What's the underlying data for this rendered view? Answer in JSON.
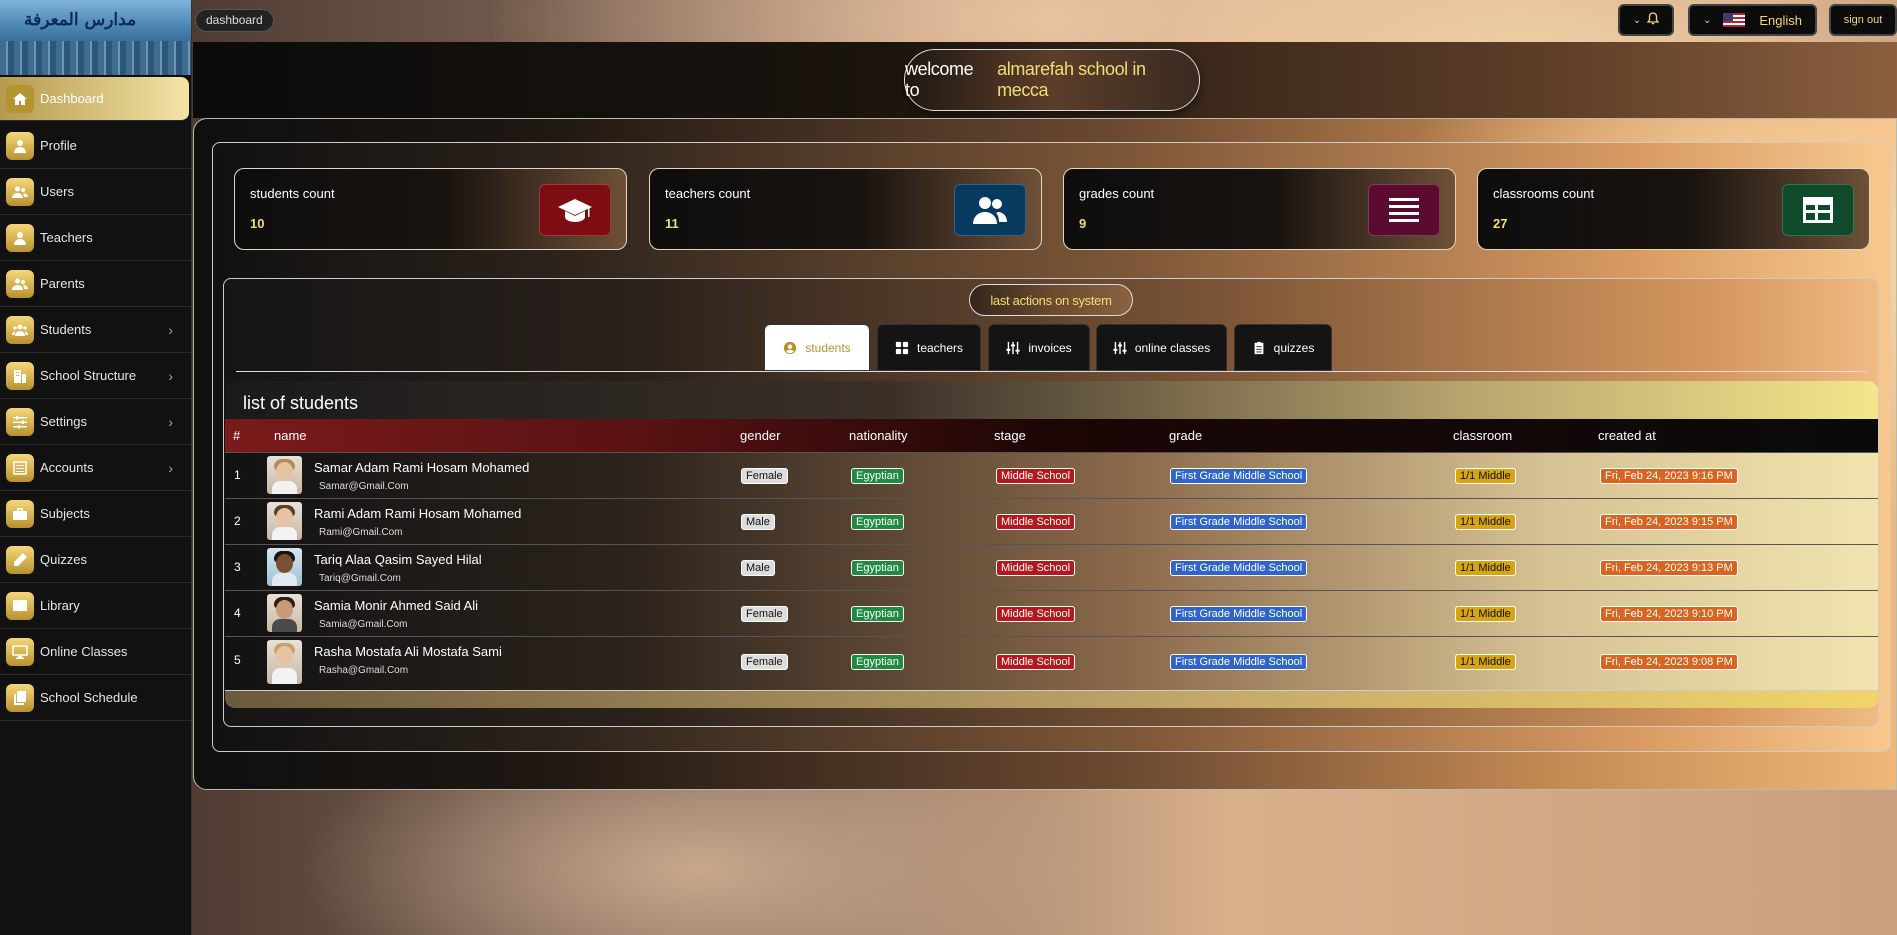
{
  "breadcrumb": "dashboard",
  "header": {
    "language": "English",
    "signout": "sign out"
  },
  "logo_text": "مدارس المعرفة",
  "welcome": {
    "prefix": "welcome to",
    "school": "almarefah school in mecca"
  },
  "sidebar": {
    "items": [
      {
        "label": "Dashboard",
        "icon": "home-icon"
      },
      {
        "label": "Profile",
        "icon": "user-icon"
      },
      {
        "label": "Users",
        "icon": "users-icon"
      },
      {
        "label": "Teachers",
        "icon": "user-icon"
      },
      {
        "label": "Parents",
        "icon": "users-icon"
      },
      {
        "label": "Students",
        "icon": "group-icon"
      },
      {
        "label": "School Structure",
        "icon": "building-icon"
      },
      {
        "label": "Settings",
        "icon": "sliders-icon"
      },
      {
        "label": "Accounts",
        "icon": "list-icon"
      },
      {
        "label": "Subjects",
        "icon": "briefcase-icon"
      },
      {
        "label": "Quizzes",
        "icon": "pencil-icon"
      },
      {
        "label": "Library",
        "icon": "book-icon"
      },
      {
        "label": "Online Classes",
        "icon": "monitor-icon"
      },
      {
        "label": "School Schedule",
        "icon": "copy-icon"
      }
    ]
  },
  "cards": [
    {
      "title": "students count",
      "value": "10",
      "icon": "graduation-cap-icon",
      "color": "#7d0d13"
    },
    {
      "title": "teachers count",
      "value": "11",
      "icon": "users-icon",
      "color": "#073a5e"
    },
    {
      "title": "grades count",
      "value": "9",
      "icon": "list-icon",
      "color": "#5a0b2f"
    },
    {
      "title": "classrooms count",
      "value": "27",
      "icon": "table-icon",
      "color": "#0f4a2b"
    }
  ],
  "last_actions": "last actions on system",
  "tabs": [
    {
      "label": "students",
      "icon": "user-circle-icon"
    },
    {
      "label": "teachers",
      "icon": "grid-icon"
    },
    {
      "label": "invoices",
      "icon": "sliders-icon"
    },
    {
      "label": "online classes",
      "icon": "sliders-icon"
    },
    {
      "label": "quizzes",
      "icon": "clipboard-icon"
    }
  ],
  "list_title": "list of students",
  "columns": [
    "#",
    "name",
    "gender",
    "nationality",
    "stage",
    "grade",
    "classroom",
    "created at"
  ],
  "students": [
    {
      "num": "1",
      "name": "Samar Adam Rami Hosam Mohamed",
      "email": "Samar@Gmail.Com",
      "gender": "Female",
      "nationality": "Egyptian",
      "stage": "Middle School",
      "grade": "First Grade Middle School",
      "classroom": "1/1 Middle",
      "created": "Fri, Feb 24, 2023 9:16 PM"
    },
    {
      "num": "2",
      "name": "Rami Adam Rami Hosam Mohamed",
      "email": "Rami@Gmail.Com",
      "gender": "Male",
      "nationality": "Egyptian",
      "stage": "Middle School",
      "grade": "First Grade Middle School",
      "classroom": "1/1 Middle",
      "created": "Fri, Feb 24, 2023 9:15 PM"
    },
    {
      "num": "3",
      "name": "Tariq Alaa Qasim Sayed Hilal",
      "email": "Tariq@Gmail.Com",
      "gender": "Male",
      "nationality": "Egyptian",
      "stage": "Middle School",
      "grade": "First Grade Middle School",
      "classroom": "1/1 Middle",
      "created": "Fri, Feb 24, 2023 9:13 PM"
    },
    {
      "num": "4",
      "name": "Samia Monir Ahmed Said Ali",
      "email": "Samia@Gmail.Com",
      "gender": "Female",
      "nationality": "Egyptian",
      "stage": "Middle School",
      "grade": "First Grade Middle School",
      "classroom": "1/1 Middle",
      "created": "Fri, Feb 24, 2023 9:10 PM"
    },
    {
      "num": "5",
      "name": "Rasha Mostafa Ali Mostafa Sami",
      "email": "Rasha@Gmail.Com",
      "gender": "Female",
      "nationality": "Egyptian",
      "stage": "Middle School",
      "grade": "First Grade Middle School",
      "classroom": "1/1 Middle",
      "created": "Fri, Feb 24, 2023 9:08 PM"
    }
  ]
}
